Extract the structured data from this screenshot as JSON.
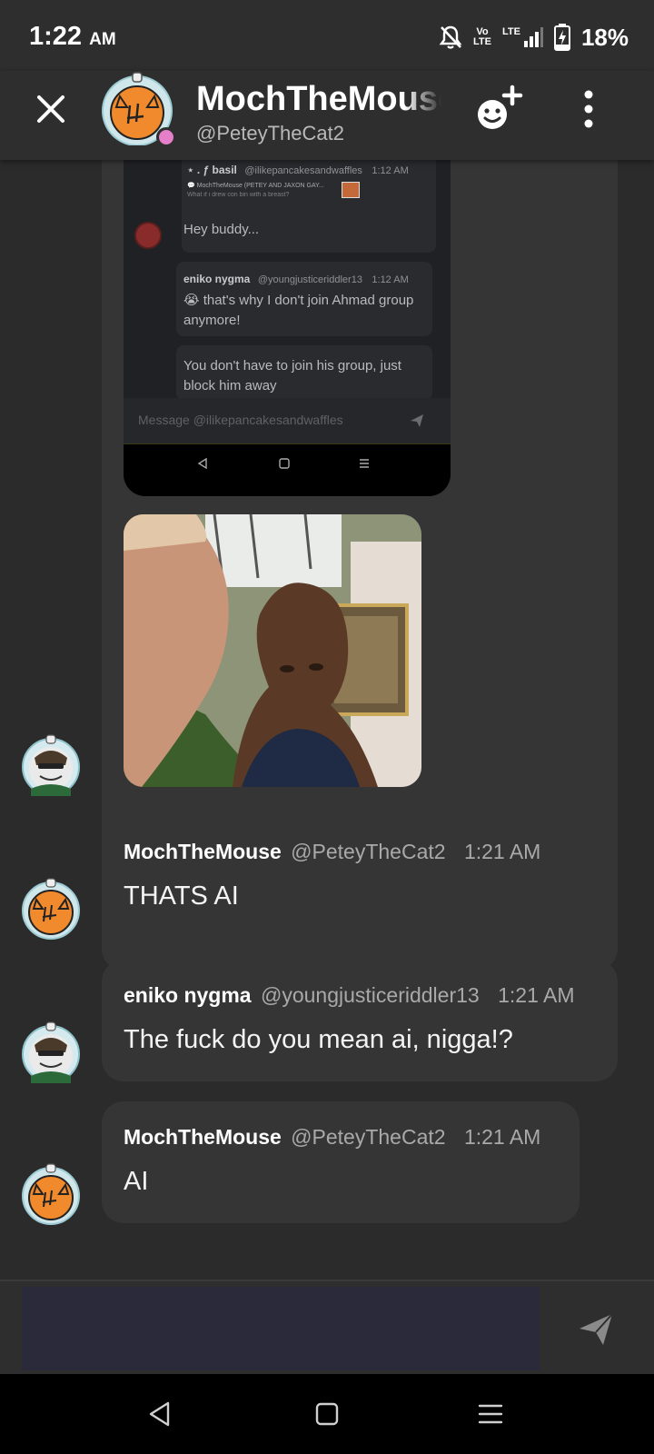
{
  "status_bar": {
    "time": "1:22",
    "ampm": "AM",
    "network_top": "Vo",
    "network_bottom": "LTE",
    "lte_label": "LTE",
    "battery_percent": "18%"
  },
  "header": {
    "name": "MochTheMouse",
    "handle": "@PeteyTheCat2",
    "presence_color": "#e57fc9"
  },
  "screenshot_msg": {
    "author": "⋆ . ƒ basil",
    "handle": "@ilikepancakesandwaffles",
    "time": "1:12 AM",
    "reply_line": "💬 MochTheMouse (PETEY AND JAXON GAY...",
    "reply_sub": "What if i drew con bin with a breast?",
    "text1": "Hey buddy...",
    "author2": "eniko nygma",
    "handle2": "@youngjusticeriddler13",
    "time2": "1:12 AM",
    "text2": "😭 that's why I don't join Ahmad group anymore!",
    "text3": "You don't have to join his group, just block him away",
    "input_placeholder": "Message @ilikepancakesandwaffles"
  },
  "messages": [
    {
      "author": "MochTheMouse",
      "handle": "@PeteyTheCat2",
      "time": "1:21 AM",
      "text": "THATS AI"
    },
    {
      "author": "eniko nygma",
      "handle": "@youngjusticeriddler13",
      "time": "1:21 AM",
      "text": "The fuck do you mean ai, nigga!?"
    },
    {
      "author": "MochTheMouse",
      "handle": "@PeteyTheCat2",
      "time": "1:21 AM",
      "text": "AI"
    }
  ],
  "composer": {
    "placeholder": ""
  },
  "colors": {
    "bg": "#2b2b2b",
    "bubble": "#353535",
    "accent_orange": "#f08a2c"
  },
  "icons": [
    "close-icon",
    "add-friend-icon",
    "more-vert-icon",
    "send-icon",
    "nav-back-icon",
    "nav-home-icon",
    "nav-menu-icon",
    "mute-icon",
    "signal-icon",
    "battery-icon"
  ]
}
